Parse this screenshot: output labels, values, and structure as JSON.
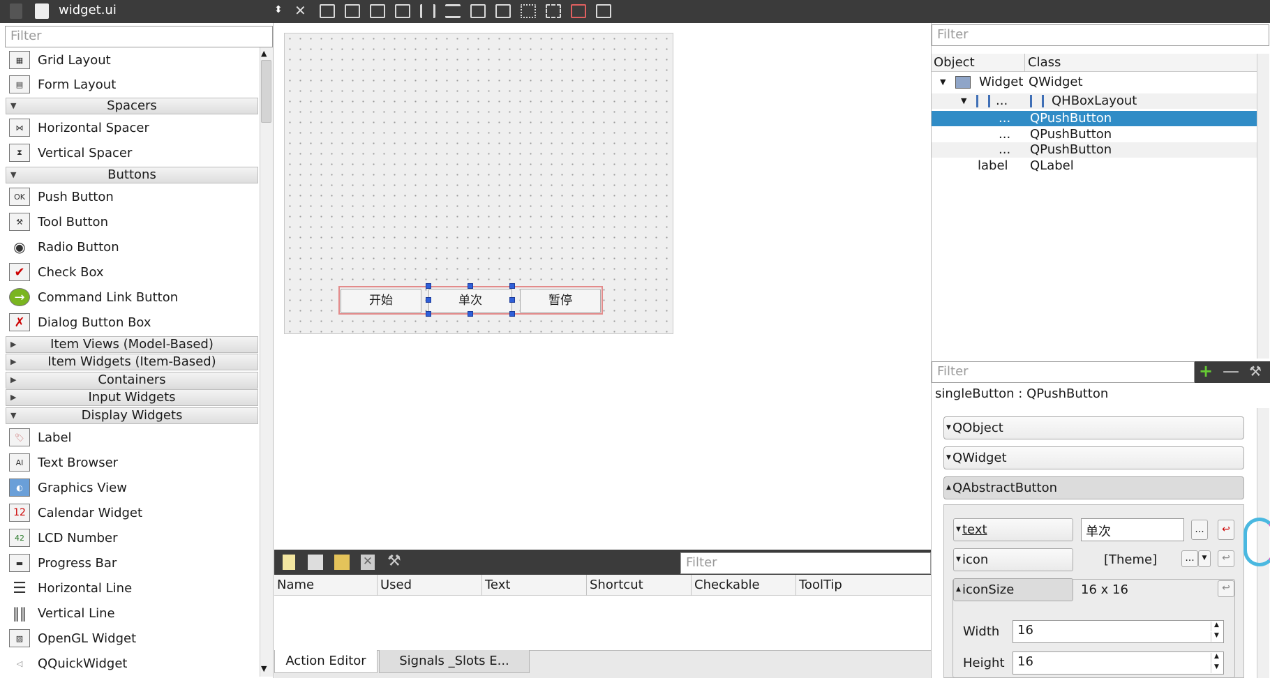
{
  "toolbar": {
    "filename": "widget.ui"
  },
  "widget_box": {
    "filter_placeholder": "Filter",
    "items_top": [
      {
        "label": "Grid Layout",
        "icon": "grid-layout-icon"
      },
      {
        "label": "Form Layout",
        "icon": "form-layout-icon"
      }
    ],
    "cat_spacers": "Spacers",
    "spacers": [
      {
        "label": "Horizontal Spacer"
      },
      {
        "label": "Vertical Spacer"
      }
    ],
    "cat_buttons": "Buttons",
    "buttons": [
      {
        "label": "Push Button",
        "glyph": "OK"
      },
      {
        "label": "Tool Button"
      },
      {
        "label": "Radio Button"
      },
      {
        "label": "Check Box"
      },
      {
        "label": "Command Link Button"
      },
      {
        "label": "Dialog Button Box"
      }
    ],
    "cat_item_views": "Item Views (Model-Based)",
    "cat_item_widgets": "Item Widgets (Item-Based)",
    "cat_containers": "Containers",
    "cat_input": "Input Widgets",
    "cat_display": "Display Widgets",
    "display": [
      {
        "label": "Label"
      },
      {
        "label": "Text Browser"
      },
      {
        "label": "Graphics View"
      },
      {
        "label": "Calendar Widget",
        "glyph": "12"
      },
      {
        "label": "LCD Number",
        "glyph": "42"
      },
      {
        "label": "Progress Bar"
      },
      {
        "label": "Horizontal Line"
      },
      {
        "label": "Vertical Line"
      },
      {
        "label": "OpenGL Widget"
      },
      {
        "label": "QQuickWidget"
      }
    ]
  },
  "form": {
    "buttons": [
      "开始",
      "单次",
      "暂停"
    ]
  },
  "action_editor": {
    "filter_placeholder": "Filter",
    "columns": [
      "Name",
      "Used",
      "Text",
      "Shortcut",
      "Checkable",
      "ToolTip"
    ],
    "tabs": [
      "Action Editor",
      "Signals _Slots E..."
    ]
  },
  "object_inspector": {
    "filter_placeholder": "Filter",
    "columns": [
      "Object",
      "Class"
    ],
    "rows": [
      {
        "object": "Widget",
        "class": "QWidget"
      },
      {
        "object": "...",
        "class": "QHBoxLayout"
      },
      {
        "object": "...",
        "class": "QPushButton"
      },
      {
        "object": "...",
        "class": "QPushButton"
      },
      {
        "object": "...",
        "class": "QPushButton"
      },
      {
        "object": "label",
        "class": "QLabel"
      }
    ]
  },
  "property_editor": {
    "filter_placeholder": "Filter",
    "title": "singleButton : QPushButton",
    "groups": [
      "QObject",
      "QWidget",
      "QAbstractButton"
    ],
    "text_name": "text",
    "text_value": "单次",
    "icon_name": "icon",
    "icon_value": "[Theme]",
    "iconsize_name": "iconSize",
    "iconsize_value": "16 x 16",
    "width_label": "Width",
    "width_value": "16",
    "height_label": "Height",
    "height_value": "16",
    "more": "..."
  }
}
